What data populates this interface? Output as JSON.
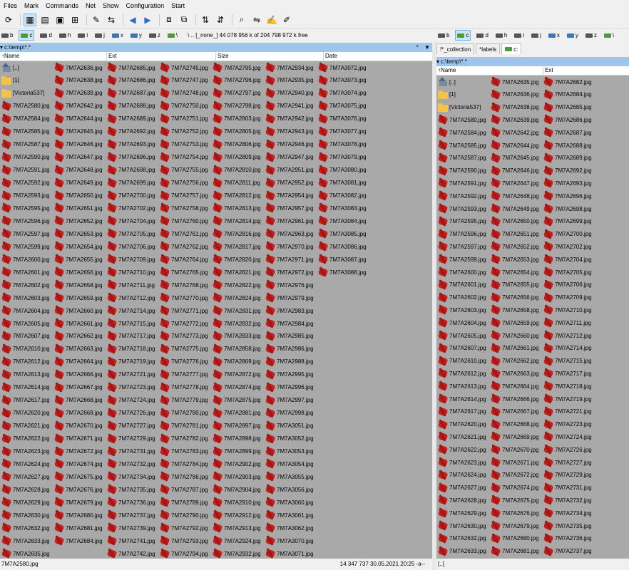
{
  "menu": [
    "Files",
    "Mark",
    "Commands",
    "Net",
    "Show",
    "Configuration",
    "Start"
  ],
  "toolbar_icons": [
    "refresh-icon",
    "brief-view-icon",
    "full-view-icon",
    "thumbnails-icon",
    "tree-icon",
    "multi-rename-icon",
    "compare-icon",
    "back-icon",
    "forward-icon",
    "pack-icon",
    "unpack-icon",
    "ftp-connect-icon",
    "ftp-new-icon",
    "search-icon",
    "sync-dirs-icon",
    "notepad-icon",
    "editor-icon"
  ],
  "left_drives": [
    {
      "letter": "b",
      "type": "drive"
    },
    {
      "letter": "c",
      "type": "drive",
      "active": true
    },
    {
      "letter": "d",
      "type": "drive"
    },
    {
      "letter": "h",
      "type": "drive"
    },
    {
      "letter": "i",
      "type": "drive"
    },
    {
      "letter": "j",
      "type": "drive"
    },
    {
      "letter": "x",
      "type": "net"
    },
    {
      "letter": "y",
      "type": "net"
    },
    {
      "letter": "z",
      "type": "drive"
    },
    {
      "letter": "\\",
      "type": "sys"
    }
  ],
  "left_free": "\\   ..  [_none_]  44 078 956 k of 204 798 972 k free",
  "right_drives": [
    {
      "letter": "b",
      "type": "drive"
    },
    {
      "letter": "c",
      "type": "drive",
      "active": true
    },
    {
      "letter": "d",
      "type": "drive"
    },
    {
      "letter": "h",
      "type": "drive"
    },
    {
      "letter": "i",
      "type": "drive"
    },
    {
      "letter": "j",
      "type": "drive"
    },
    {
      "letter": "x",
      "type": "net"
    },
    {
      "letter": "y",
      "type": "net"
    },
    {
      "letter": "z",
      "type": "drive"
    },
    {
      "letter": "\\",
      "type": "sys"
    }
  ],
  "left": {
    "path": "c:\\temp\\*.*",
    "path_buttons": [
      "*",
      "▼"
    ],
    "headers": [
      "Name",
      "Ext",
      "Size",
      "Date"
    ],
    "specials": [
      "[..]",
      "[1]",
      "[Victoria537]"
    ],
    "columns": [
      [
        "7M7A2580.jpg",
        "7M7A2584.jpg",
        "7M7A2585.jpg",
        "7M7A2587.jpg",
        "7M7A2590.jpg",
        "7M7A2591.jpg",
        "7M7A2592.jpg",
        "7M7A2593.jpg",
        "7M7A2595.jpg",
        "7M7A2596.jpg",
        "7M7A2597.jpg",
        "7M7A2599.jpg",
        "7M7A2600.jpg",
        "7M7A2601.jpg",
        "7M7A2602.jpg",
        "7M7A2603.jpg",
        "7M7A2604.jpg",
        "7M7A2605.jpg",
        "7M7A2607.jpg",
        "7M7A2610.jpg",
        "7M7A2612.jpg",
        "7M7A2613.jpg",
        "7M7A2614.jpg",
        "7M7A2617.jpg",
        "7M7A2620.jpg",
        "7M7A2621.jpg",
        "7M7A2622.jpg",
        "7M7A2623.jpg",
        "7M7A2624.jpg",
        "7M7A2627.jpg",
        "7M7A2628.jpg",
        "7M7A2629.jpg",
        "7M7A2630.jpg",
        "7M7A2632.jpg",
        "7M7A2633.jpg",
        "7M7A2635.jpg"
      ],
      [
        "7M7A2636.jpg",
        "7M7A2638.jpg",
        "7M7A2639.jpg",
        "7M7A2642.jpg",
        "7M7A2644.jpg",
        "7M7A2645.jpg",
        "7M7A2646.jpg",
        "7M7A2647.jpg",
        "7M7A2648.jpg",
        "7M7A2649.jpg",
        "7M7A2650.jpg",
        "7M7A2651.jpg",
        "7M7A2652.jpg",
        "7M7A2653.jpg",
        "7M7A2654.jpg",
        "7M7A2655.jpg",
        "7M7A2656.jpg",
        "7M7A2658.jpg",
        "7M7A2659.jpg",
        "7M7A2660.jpg",
        "7M7A2661.jpg",
        "7M7A2662.jpg",
        "7M7A2663.jpg",
        "7M7A2664.jpg",
        "7M7A2666.jpg",
        "7M7A2667.jpg",
        "7M7A2668.jpg",
        "7M7A2669.jpg",
        "7M7A2670.jpg",
        "7M7A2671.jpg",
        "7M7A2672.jpg",
        "7M7A2674.jpg",
        "7M7A2675.jpg",
        "7M7A2676.jpg",
        "7M7A2679.jpg",
        "7M7A2680.jpg",
        "7M7A2681.jpg",
        "7M7A2684.jpg"
      ],
      [
        "7M7A2685.jpg",
        "7M7A2686.jpg",
        "7M7A2687.jpg",
        "7M7A2688.jpg",
        "7M7A2689.jpg",
        "7M7A2692.jpg",
        "7M7A2693.jpg",
        "7M7A2696.jpg",
        "7M7A2698.jpg",
        "7M7A2699.jpg",
        "7M7A2700.jpg",
        "7M7A2702.jpg",
        "7M7A2704.jpg",
        "7M7A2705.jpg",
        "7M7A2706.jpg",
        "7M7A2709.jpg",
        "7M7A2710.jpg",
        "7M7A2711.jpg",
        "7M7A2712.jpg",
        "7M7A2714.jpg",
        "7M7A2715.jpg",
        "7M7A2717.jpg",
        "7M7A2718.jpg",
        "7M7A2719.jpg",
        "7M7A2721.jpg",
        "7M7A2723.jpg",
        "7M7A2724.jpg",
        "7M7A2726.jpg",
        "7M7A2727.jpg",
        "7M7A2729.jpg",
        "7M7A2731.jpg",
        "7M7A2732.jpg",
        "7M7A2734.jpg",
        "7M7A2735.jpg",
        "7M7A2736.jpg",
        "7M7A2737.jpg",
        "7M7A2739.jpg",
        "7M7A2741.jpg",
        "7M7A2742.jpg"
      ],
      [
        "7M7A2745.jpg",
        "7M7A2747.jpg",
        "7M7A2748.jpg",
        "7M7A2750.jpg",
        "7M7A2751.jpg",
        "7M7A2752.jpg",
        "7M7A2753.jpg",
        "7M7A2754.jpg",
        "7M7A2755.jpg",
        "7M7A2756.jpg",
        "7M7A2757.jpg",
        "7M7A2758.jpg",
        "7M7A2760.jpg",
        "7M7A2761.jpg",
        "7M7A2762.jpg",
        "7M7A2764.jpg",
        "7M7A2765.jpg",
        "7M7A2768.jpg",
        "7M7A2770.jpg",
        "7M7A2771.jpg",
        "7M7A2772.jpg",
        "7M7A2773.jpg",
        "7M7A2775.jpg",
        "7M7A2776.jpg",
        "7M7A2777.jpg",
        "7M7A2778.jpg",
        "7M7A2779.jpg",
        "7M7A2780.jpg",
        "7M7A2781.jpg",
        "7M7A2782.jpg",
        "7M7A2783.jpg",
        "7M7A2784.jpg",
        "7M7A2786.jpg",
        "7M7A2787.jpg",
        "7M7A2789.jpg",
        "7M7A2790.jpg",
        "7M7A2792.jpg",
        "7M7A2793.jpg",
        "7M7A2794.jpg"
      ],
      [
        "7M7A2795.jpg",
        "7M7A2796.jpg",
        "7M7A2797.jpg",
        "7M7A2798.jpg",
        "7M7A2803.jpg",
        "7M7A2805.jpg",
        "7M7A2806.jpg",
        "7M7A2809.jpg",
        "7M7A2810.jpg",
        "7M7A2811.jpg",
        "7M7A2812.jpg",
        "7M7A2813.jpg",
        "7M7A2814.jpg",
        "7M7A2816.jpg",
        "7M7A2817.jpg",
        "7M7A2820.jpg",
        "7M7A2821.jpg",
        "7M7A2822.jpg",
        "7M7A2824.jpg",
        "7M7A2831.jpg",
        "7M7A2832.jpg",
        "7M7A2833.jpg",
        "7M7A2858.jpg",
        "7M7A2869.jpg",
        "7M7A2872.jpg",
        "7M7A2874.jpg",
        "7M7A2875.jpg",
        "7M7A2881.jpg",
        "7M7A2897.jpg",
        "7M7A2898.jpg",
        "7M7A2899.jpg",
        "7M7A2902.jpg",
        "7M7A2903.jpg",
        "7M7A2904.jpg",
        "7M7A2910.jpg",
        "7M7A2912.jpg",
        "7M7A2913.jpg",
        "7M7A2924.jpg",
        "7M7A2932.jpg"
      ],
      [
        "7M7A2934.jpg",
        "7M7A2935.jpg",
        "7M7A2940.jpg",
        "7M7A2941.jpg",
        "7M7A2942.jpg",
        "7M7A2943.jpg",
        "7M7A2946.jpg",
        "7M7A2947.jpg",
        "7M7A2951.jpg",
        "7M7A2952.jpg",
        "7M7A2954.jpg",
        "7M7A2957.jpg",
        "7M7A2961.jpg",
        "7M7A2963.jpg",
        "7M7A2970.jpg",
        "7M7A2971.jpg",
        "7M7A2972.jpg",
        "7M7A2976.jpg",
        "7M7A2979.jpg",
        "7M7A2983.jpg",
        "7M7A2984.jpg",
        "7M7A2985.jpg",
        "7M7A2986.jpg",
        "7M7A2988.jpg",
        "7M7A2995.jpg",
        "7M7A2996.jpg",
        "7M7A2997.jpg",
        "7M7A2998.jpg",
        "7M7A3051.jpg",
        "7M7A3052.jpg",
        "7M7A3053.jpg",
        "7M7A3054.jpg",
        "7M7A3055.jpg",
        "7M7A3056.jpg",
        "7M7A3060.jpg",
        "7M7A3061.jpg",
        "7M7A3062.jpg",
        "7M7A3070.jpg",
        "7M7A3071.jpg"
      ],
      [
        "7M7A3072.jpg",
        "7M7A3073.jpg",
        "7M7A3074.jpg",
        "7M7A3075.jpg",
        "7M7A3076.jpg",
        "7M7A3077.jpg",
        "7M7A3078.jpg",
        "7M7A3079.jpg",
        "7M7A3080.jpg",
        "7M7A3081.jpg",
        "7M7A3082.jpg",
        "7M7A3083.jpg",
        "7M7A3084.jpg",
        "7M7A3085.jpg",
        "7M7A3086.jpg",
        "7M7A3087.jpg",
        "7M7A3088.jpg"
      ]
    ],
    "status_file": "7M7A2580.jpg",
    "status_info": "14 347 737  30.05.2021 20:25   -a--"
  },
  "right": {
    "tabs": [
      "!*_collection",
      "*labels",
      "c:"
    ],
    "path": "c:\\temp\\*.*",
    "headers": [
      "Name",
      "Ext"
    ],
    "specials": [
      "[..]",
      "[1]",
      "[Victoria537]"
    ],
    "columns": [
      [
        "7M7A2580.jpg",
        "7M7A2584.jpg",
        "7M7A2585.jpg",
        "7M7A2587.jpg",
        "7M7A2590.jpg",
        "7M7A2591.jpg",
        "7M7A2592.jpg",
        "7M7A2593.jpg",
        "7M7A2595.jpg",
        "7M7A2596.jpg",
        "7M7A2597.jpg",
        "7M7A2599.jpg",
        "7M7A2600.jpg",
        "7M7A2601.jpg",
        "7M7A2602.jpg",
        "7M7A2603.jpg",
        "7M7A2604.jpg",
        "7M7A2605.jpg",
        "7M7A2607.jpg",
        "7M7A2610.jpg",
        "7M7A2612.jpg",
        "7M7A2613.jpg",
        "7M7A2614.jpg",
        "7M7A2617.jpg",
        "7M7A2620.jpg",
        "7M7A2621.jpg",
        "7M7A2622.jpg",
        "7M7A2623.jpg",
        "7M7A2624.jpg",
        "7M7A2627.jpg",
        "7M7A2628.jpg",
        "7M7A2629.jpg",
        "7M7A2630.jpg",
        "7M7A2632.jpg",
        "7M7A2633.jpg"
      ],
      [
        "7M7A2635.jpg",
        "7M7A2636.jpg",
        "7M7A2638.jpg",
        "7M7A2639.jpg",
        "7M7A2642.jpg",
        "7M7A2644.jpg",
        "7M7A2645.jpg",
        "7M7A2646.jpg",
        "7M7A2647.jpg",
        "7M7A2648.jpg",
        "7M7A2649.jpg",
        "7M7A2650.jpg",
        "7M7A2651.jpg",
        "7M7A2652.jpg",
        "7M7A2653.jpg",
        "7M7A2654.jpg",
        "7M7A2655.jpg",
        "7M7A2656.jpg",
        "7M7A2658.jpg",
        "7M7A2659.jpg",
        "7M7A2660.jpg",
        "7M7A2661.jpg",
        "7M7A2662.jpg",
        "7M7A2663.jpg",
        "7M7A2664.jpg",
        "7M7A2666.jpg",
        "7M7A2667.jpg",
        "7M7A2668.jpg",
        "7M7A2669.jpg",
        "7M7A2670.jpg",
        "7M7A2671.jpg",
        "7M7A2672.jpg",
        "7M7A2674.jpg",
        "7M7A2675.jpg",
        "7M7A2676.jpg",
        "7M7A2679.jpg",
        "7M7A2680.jpg",
        "7M7A2681.jpg"
      ],
      [
        "7M7A2682.jpg",
        "7M7A2684.jpg",
        "7M7A2685.jpg",
        "7M7A2686.jpg",
        "7M7A2687.jpg",
        "7M7A2688.jpg",
        "7M7A2689.jpg",
        "7M7A2692.jpg",
        "7M7A2693.jpg",
        "7M7A2696.jpg",
        "7M7A2698.jpg",
        "7M7A2699.jpg",
        "7M7A2700.jpg",
        "7M7A2702.jpg",
        "7M7A2704.jpg",
        "7M7A2705.jpg",
        "7M7A2706.jpg",
        "7M7A2709.jpg",
        "7M7A2710.jpg",
        "7M7A2711.jpg",
        "7M7A2712.jpg",
        "7M7A2714.jpg",
        "7M7A2715.jpg",
        "7M7A2717.jpg",
        "7M7A2718.jpg",
        "7M7A2719.jpg",
        "7M7A2721.jpg",
        "7M7A2723.jpg",
        "7M7A2724.jpg",
        "7M7A2726.jpg",
        "7M7A2727.jpg",
        "7M7A2729.jpg",
        "7M7A2731.jpg",
        "7M7A2732.jpg",
        "7M7A2734.jpg",
        "7M7A2735.jpg",
        "7M7A2736.jpg",
        "7M7A2737.jpg"
      ]
    ],
    "right_col_prefix": "7M7A2",
    "status_file": "[..]"
  }
}
